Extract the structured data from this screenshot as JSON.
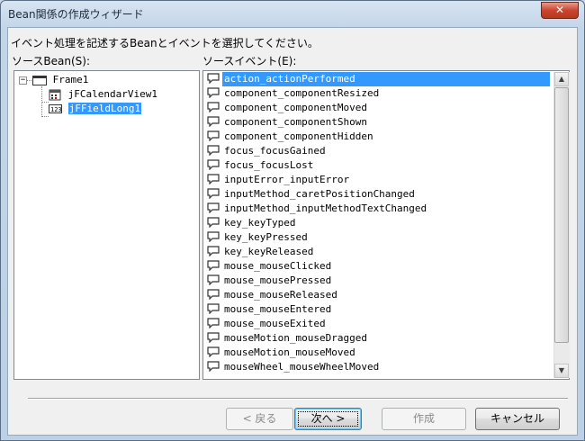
{
  "window": {
    "title": "Bean関係の作成ウィザード",
    "close_label": "✕"
  },
  "instruction": "イベント処理を記述するBeanとイベントを選択してください。",
  "source_bean": {
    "label": "ソースBean(S):",
    "tree": [
      {
        "label": "Frame1",
        "expander": "−",
        "icon": "frame-icon"
      },
      {
        "label": "jFCalendarView1",
        "icon": "calendar-component-icon"
      },
      {
        "label": "jFFieldLong1",
        "icon": "numeric-field-icon",
        "selected": true
      }
    ]
  },
  "source_event": {
    "label": "ソースイベント(E):",
    "items": [
      "action_actionPerformed",
      "component_componentResized",
      "component_componentMoved",
      "component_componentShown",
      "component_componentHidden",
      "focus_focusGained",
      "focus_focusLost",
      "inputError_inputError",
      "inputMethod_caretPositionChanged",
      "inputMethod_inputMethodTextChanged",
      "key_keyTyped",
      "key_keyPressed",
      "key_keyReleased",
      "mouse_mouseClicked",
      "mouse_mousePressed",
      "mouse_mouseReleased",
      "mouse_mouseEntered",
      "mouse_mouseExited",
      "mouseMotion_mouseDragged",
      "mouseMotion_mouseMoved",
      "mouseWheel_mouseWheelMoved"
    ],
    "selected_index": 0,
    "icon": "event-bubble-icon"
  },
  "buttons": {
    "back": "< 戻る",
    "next": "次へ >",
    "finish": "作成",
    "cancel": "キャンセル"
  },
  "colors": {
    "selection": "#3399ff",
    "panel_border": "#828790"
  }
}
